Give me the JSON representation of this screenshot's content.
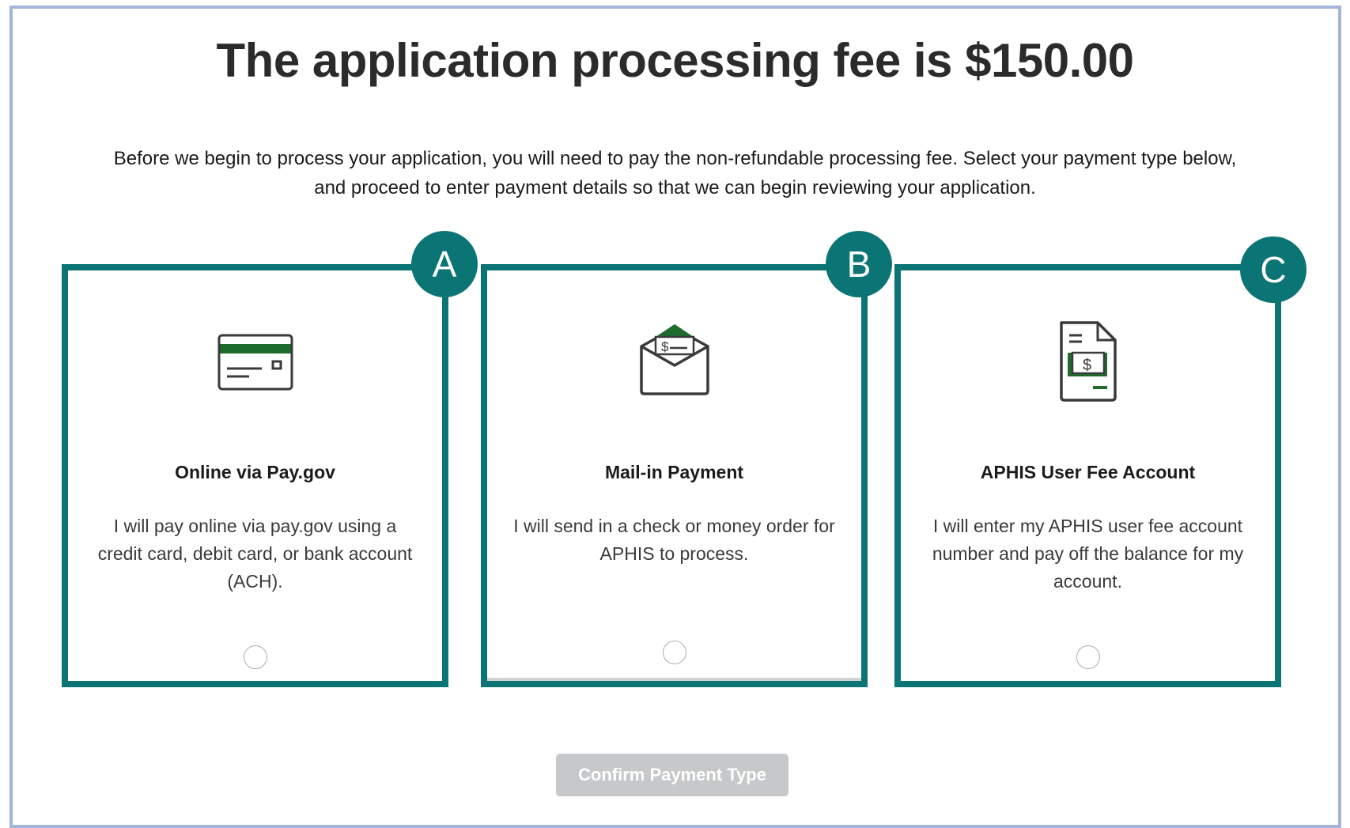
{
  "page": {
    "title": "The application processing fee is $150.00",
    "intro_line1": "Before we begin to process your application, you will need to pay the non-refundable processing fee. Select your payment type below,",
    "intro_line2": "and proceed to enter payment details so that we can begin reviewing your application."
  },
  "options": [
    {
      "badge": "A",
      "icon": "credit-card-icon",
      "title": "Online via Pay.gov",
      "description": "I will pay online via pay.gov using a credit card, debit card, or bank account (ACH).",
      "selected": false
    },
    {
      "badge": "B",
      "icon": "envelope-check-icon",
      "title": "Mail-in Payment",
      "description": "I will send in a check or money order for APHIS to process.",
      "selected": false
    },
    {
      "badge": "C",
      "icon": "fee-account-document-icon",
      "title": "APHIS User Fee Account",
      "description": "I will enter my APHIS user fee account number and pay off the balance for my account.",
      "selected": false
    }
  ],
  "confirm_button": {
    "label": "Confirm Payment Type",
    "disabled": true
  },
  "colors": {
    "accent_teal": "#0b7474",
    "icon_green": "#1e6b2e",
    "frame_border": "#a3b5d9",
    "disabled_button": "#c6c8ca"
  }
}
